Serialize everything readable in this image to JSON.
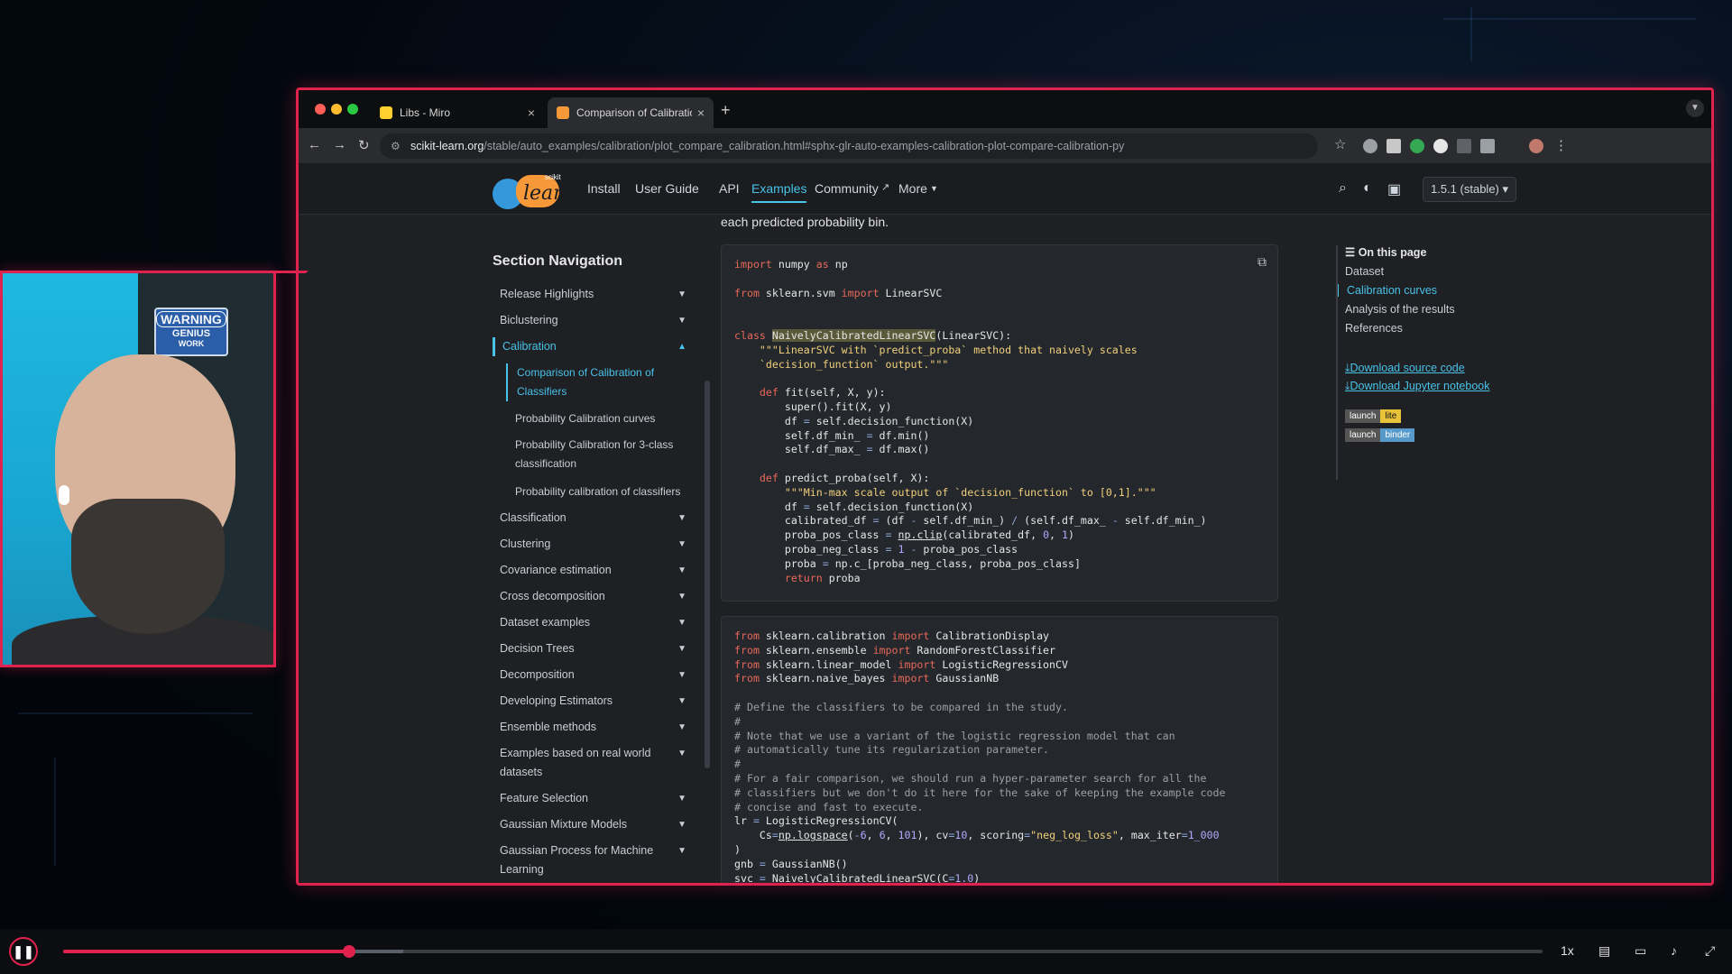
{
  "browser": {
    "tabs": [
      {
        "label": "Libs - Miro",
        "close": "×"
      },
      {
        "label": "Comparison of Calibration of",
        "close": "×"
      }
    ],
    "new_tab": "+",
    "url_domain": "scikit-learn.org",
    "url_path": "/stable/auto_examples/calibration/plot_compare_calibration.html#sphx-glr-auto-examples-calibration-plot-compare-calibration-py"
  },
  "site": {
    "logo_text": "learn",
    "logo_small": "scikit",
    "nav": [
      "Install",
      "User Guide",
      "API",
      "Examples",
      "Community",
      "More"
    ],
    "active_nav": "Examples",
    "version": "1.5.1 (stable)"
  },
  "sidebar": {
    "title": "Section Navigation",
    "items": [
      "Release Highlights",
      "Biclustering",
      "Calibration",
      "Classification",
      "Clustering",
      "Covariance estimation",
      "Cross decomposition",
      "Dataset examples",
      "Decision Trees",
      "Decomposition",
      "Developing Estimators",
      "Ensemble methods",
      "Examples based on real world datasets",
      "Feature Selection",
      "Gaussian Mixture Models",
      "Gaussian Process for Machine Learning"
    ],
    "sub_items": [
      "Comparison of Calibration of Classifiers",
      "Probability Calibration curves",
      "Probability Calibration for 3-class classification",
      "Probability calibration of classifiers"
    ]
  },
  "content": {
    "lead": "each predicted probability bin."
  },
  "toc": {
    "title": "On this page",
    "items": [
      "Dataset",
      "Calibration curves",
      "Analysis of the results",
      "References"
    ],
    "active": "Calibration curves",
    "download_source": "Download source code",
    "download_notebook": "Download Jupyter notebook",
    "badges": [
      {
        "left": "launch",
        "right": "lite"
      },
      {
        "left": "launch",
        "right": "binder"
      }
    ]
  },
  "webcam": {
    "sign_line1": "WARNING",
    "sign_line2": "GENIUS",
    "sign_line3": "WORK"
  },
  "player": {
    "progress": 0.193,
    "buffered": 0.23,
    "speed": "1x"
  },
  "colors": {
    "accent": "#e0234e",
    "link": "#49c2e8",
    "page_bg": "#1e2024"
  }
}
